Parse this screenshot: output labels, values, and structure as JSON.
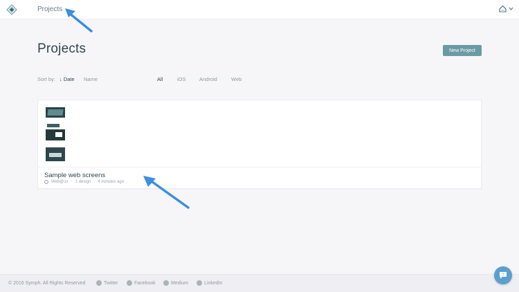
{
  "topbar": {
    "nav_projects": "Projects",
    "logo_icon": "symph-logo-icon",
    "account_icon": "account-icon",
    "chevron_icon": "chevron-down-icon"
  },
  "page": {
    "title": "Projects",
    "new_project_label": "New Project"
  },
  "sort": {
    "label": "Sort by:",
    "date": "↓ Date",
    "name": "Name"
  },
  "filters": [
    "All",
    "iOS",
    "Android",
    "Web"
  ],
  "active_filter": "All",
  "project": {
    "title": "Sample web screens",
    "platform": "Web@1x",
    "designs": "1 design",
    "updated": "4 minutes ago",
    "separator": "·"
  },
  "footer": {
    "copyright": "© 2016 Symph. All Rights Reserved",
    "links": [
      "Twitter",
      "Facebook",
      "Medium",
      "LinkedIn"
    ]
  },
  "colors": {
    "accent": "#6a9aa3",
    "arrow": "#3a8fe0",
    "chat": "#5a9fcf"
  }
}
